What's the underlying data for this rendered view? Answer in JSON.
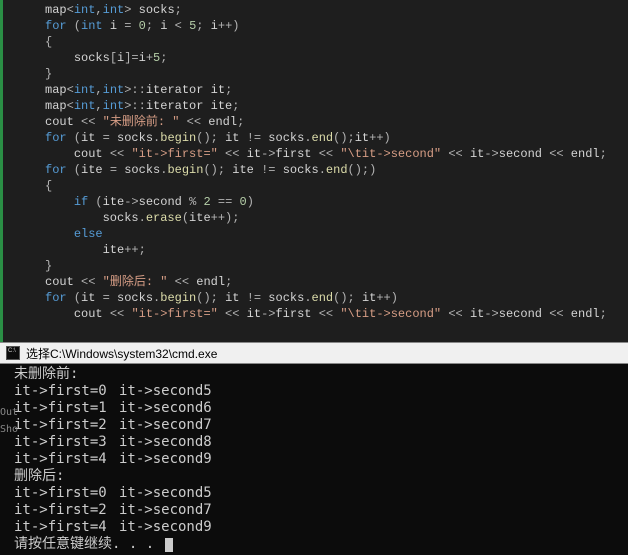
{
  "code_lines": [
    [
      [
        "t-id",
        "map"
      ],
      [
        "t-op",
        "<"
      ],
      [
        "t-type",
        "int"
      ],
      [
        "t-op",
        ","
      ],
      [
        "t-type",
        "int"
      ],
      [
        "t-op",
        "> "
      ],
      [
        "t-id",
        "socks"
      ],
      [
        "t-op",
        ";"
      ]
    ],
    [
      [
        "t-kw",
        "for"
      ],
      [
        "t-op",
        " ("
      ],
      [
        "t-type",
        "int"
      ],
      [
        "t-id",
        " i "
      ],
      [
        "t-op",
        "= "
      ],
      [
        "t-num",
        "0"
      ],
      [
        "t-op",
        "; "
      ],
      [
        "t-id",
        "i "
      ],
      [
        "t-op",
        "< "
      ],
      [
        "t-num",
        "5"
      ],
      [
        "t-op",
        "; "
      ],
      [
        "t-id",
        "i"
      ],
      [
        "t-op",
        "++)"
      ]
    ],
    [
      [
        "t-op",
        "{"
      ]
    ],
    [
      [
        "",
        "    "
      ],
      [
        "t-id",
        "socks"
      ],
      [
        "t-op",
        "["
      ],
      [
        "t-id",
        "i"
      ],
      [
        "t-op",
        "]="
      ],
      [
        "t-id",
        "i"
      ],
      [
        "t-op",
        "+"
      ],
      [
        "t-num",
        "5"
      ],
      [
        "t-op",
        ";"
      ]
    ],
    [
      [
        "t-op",
        "}"
      ]
    ],
    [
      [
        "t-id",
        "map"
      ],
      [
        "t-op",
        "<"
      ],
      [
        "t-type",
        "int"
      ],
      [
        "t-op",
        ","
      ],
      [
        "t-type",
        "int"
      ],
      [
        "t-op",
        ">::"
      ],
      [
        "t-id",
        "iterator it"
      ],
      [
        "t-op",
        ";"
      ]
    ],
    [
      [
        "t-id",
        "map"
      ],
      [
        "t-op",
        "<"
      ],
      [
        "t-type",
        "int"
      ],
      [
        "t-op",
        ","
      ],
      [
        "t-type",
        "int"
      ],
      [
        "t-op",
        ">::"
      ],
      [
        "t-id",
        "iterator ite"
      ],
      [
        "t-op",
        ";"
      ]
    ],
    [
      [
        "t-id",
        "cout "
      ],
      [
        "t-op",
        "<< "
      ],
      [
        "t-str",
        "\"未删除前: \""
      ],
      [
        "t-op",
        " << "
      ],
      [
        "t-id",
        "endl"
      ],
      [
        "t-op",
        ";"
      ]
    ],
    [
      [
        "t-kw",
        "for"
      ],
      [
        "t-op",
        " ("
      ],
      [
        "t-id",
        "it "
      ],
      [
        "t-op",
        "= "
      ],
      [
        "t-id",
        "socks"
      ],
      [
        "t-op",
        "."
      ],
      [
        "t-func",
        "begin"
      ],
      [
        "t-op",
        "(); "
      ],
      [
        "t-id",
        "it "
      ],
      [
        "t-op",
        "!= "
      ],
      [
        "t-id",
        "socks"
      ],
      [
        "t-op",
        "."
      ],
      [
        "t-func",
        "end"
      ],
      [
        "t-op",
        "();"
      ],
      [
        "t-id",
        "it"
      ],
      [
        "t-op",
        "++)"
      ]
    ],
    [
      [
        "",
        "    "
      ],
      [
        "t-id",
        "cout "
      ],
      [
        "t-op",
        "<< "
      ],
      [
        "t-str",
        "\"it->first=\""
      ],
      [
        "t-op",
        " << "
      ],
      [
        "t-id",
        "it"
      ],
      [
        "t-op",
        "->"
      ],
      [
        "t-id",
        "first "
      ],
      [
        "t-op",
        "<< "
      ],
      [
        "t-str",
        "\"\\tit->second\""
      ],
      [
        "t-op",
        " << "
      ],
      [
        "t-id",
        "it"
      ],
      [
        "t-op",
        "->"
      ],
      [
        "t-id",
        "second "
      ],
      [
        "t-op",
        "<< "
      ],
      [
        "t-id",
        "endl"
      ],
      [
        "t-op",
        ";"
      ]
    ],
    [
      [
        "t-kw",
        "for"
      ],
      [
        "t-op",
        " ("
      ],
      [
        "t-id",
        "ite "
      ],
      [
        "t-op",
        "= "
      ],
      [
        "t-id",
        "socks"
      ],
      [
        "t-op",
        "."
      ],
      [
        "t-func",
        "begin"
      ],
      [
        "t-op",
        "(); "
      ],
      [
        "t-id",
        "ite "
      ],
      [
        "t-op",
        "!= "
      ],
      [
        "t-id",
        "socks"
      ],
      [
        "t-op",
        "."
      ],
      [
        "t-func",
        "end"
      ],
      [
        "t-op",
        "();)"
      ]
    ],
    [
      [
        "t-op",
        "{"
      ]
    ],
    [
      [
        "",
        "    "
      ],
      [
        "t-kw",
        "if"
      ],
      [
        "t-op",
        " ("
      ],
      [
        "t-id",
        "ite"
      ],
      [
        "t-op",
        "->"
      ],
      [
        "t-id",
        "second "
      ],
      [
        "t-op",
        "% "
      ],
      [
        "t-num",
        "2"
      ],
      [
        "t-op",
        " == "
      ],
      [
        "t-num",
        "0"
      ],
      [
        "t-op",
        ")"
      ]
    ],
    [
      [
        "",
        "        "
      ],
      [
        "t-id",
        "socks"
      ],
      [
        "t-op",
        "."
      ],
      [
        "t-func",
        "erase"
      ],
      [
        "t-op",
        "("
      ],
      [
        "t-id",
        "ite"
      ],
      [
        "t-op",
        "++);"
      ]
    ],
    [
      [
        "",
        "    "
      ],
      [
        "t-kw",
        "else"
      ]
    ],
    [
      [
        "",
        "        "
      ],
      [
        "t-id",
        "ite"
      ],
      [
        "t-op",
        "++;"
      ]
    ],
    [
      [
        "t-op",
        "}"
      ]
    ],
    [
      [
        "t-id",
        "cout "
      ],
      [
        "t-op",
        "<< "
      ],
      [
        "t-str",
        "\"删除后: \""
      ],
      [
        "t-op",
        " << "
      ],
      [
        "t-id",
        "endl"
      ],
      [
        "t-op",
        ";"
      ]
    ],
    [
      [
        "t-kw",
        "for"
      ],
      [
        "t-op",
        " ("
      ],
      [
        "t-id",
        "it "
      ],
      [
        "t-op",
        "= "
      ],
      [
        "t-id",
        "socks"
      ],
      [
        "t-op",
        "."
      ],
      [
        "t-func",
        "begin"
      ],
      [
        "t-op",
        "(); "
      ],
      [
        "t-id",
        "it "
      ],
      [
        "t-op",
        "!= "
      ],
      [
        "t-id",
        "socks"
      ],
      [
        "t-op",
        "."
      ],
      [
        "t-func",
        "end"
      ],
      [
        "t-op",
        "(); "
      ],
      [
        "t-id",
        "it"
      ],
      [
        "t-op",
        "++)"
      ]
    ],
    [
      [
        "",
        "    "
      ],
      [
        "t-id",
        "cout "
      ],
      [
        "t-op",
        "<< "
      ],
      [
        "t-str",
        "\"it->first=\""
      ],
      [
        "t-op",
        " << "
      ],
      [
        "t-id",
        "it"
      ],
      [
        "t-op",
        "->"
      ],
      [
        "t-id",
        "first "
      ],
      [
        "t-op",
        "<< "
      ],
      [
        "t-str",
        "\"\\tit->second\""
      ],
      [
        "t-op",
        " << "
      ],
      [
        "t-id",
        "it"
      ],
      [
        "t-op",
        "->"
      ],
      [
        "t-id",
        "second "
      ],
      [
        "t-op",
        "<< "
      ],
      [
        "t-id",
        "endl"
      ],
      [
        "t-op",
        ";"
      ]
    ]
  ],
  "terminal": {
    "title": "选择C:\\Windows\\system32\\cmd.exe",
    "side_labels": [
      "Out",
      "Sho"
    ],
    "lines": [
      {
        "type": "text",
        "text": "未删除前:"
      },
      {
        "type": "pair",
        "first": "it->first=0",
        "second": "it->second5"
      },
      {
        "type": "pair",
        "first": "it->first=1",
        "second": "it->second6"
      },
      {
        "type": "pair",
        "first": "it->first=2",
        "second": "it->second7"
      },
      {
        "type": "pair",
        "first": "it->first=3",
        "second": "it->second8"
      },
      {
        "type": "pair",
        "first": "it->first=4",
        "second": "it->second9"
      },
      {
        "type": "text",
        "text": "删除后:"
      },
      {
        "type": "pair",
        "first": "it->first=0",
        "second": "it->second5"
      },
      {
        "type": "pair",
        "first": "it->first=2",
        "second": "it->second7"
      },
      {
        "type": "pair",
        "first": "it->first=4",
        "second": "it->second9"
      },
      {
        "type": "prompt",
        "text": "请按任意键继续. . . "
      }
    ]
  }
}
